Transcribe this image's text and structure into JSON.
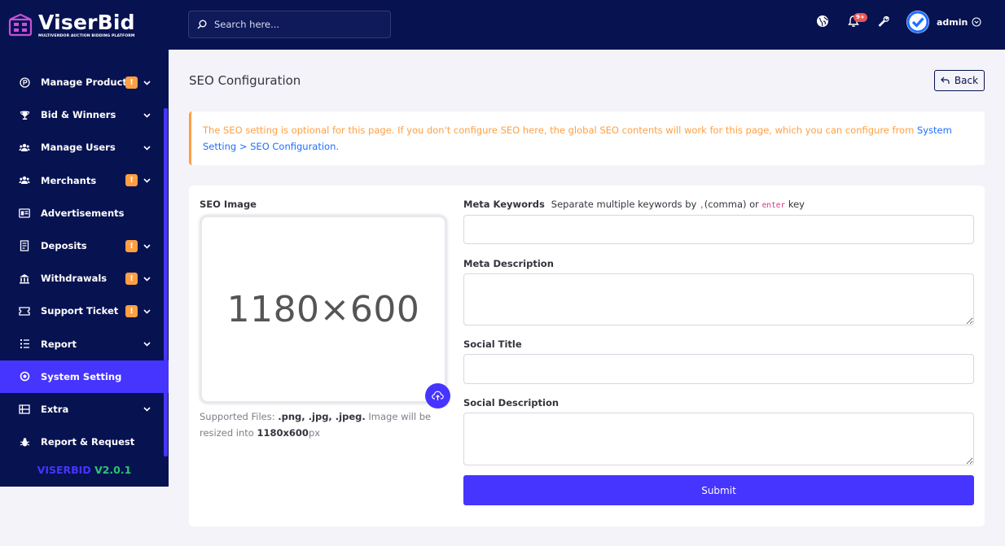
{
  "brand": {
    "name": "ViserBid",
    "tagline": "MULTIVENDOR AUCTION BIDDING PLATFORM"
  },
  "sidebar": {
    "items": [
      {
        "label": "Manage Products",
        "icon": "product-icon",
        "badge": "!",
        "has_chevron": true
      },
      {
        "label": "Bid & Winners",
        "icon": "trophy-icon",
        "badge": "",
        "has_chevron": true
      },
      {
        "label": "Manage Users",
        "icon": "users-icon",
        "badge": "",
        "has_chevron": true
      },
      {
        "label": "Merchants",
        "icon": "merchants-icon",
        "badge": "!",
        "has_chevron": true
      },
      {
        "label": "Advertisements",
        "icon": "ad-icon",
        "badge": "",
        "has_chevron": false
      },
      {
        "label": "Deposits",
        "icon": "deposit-icon",
        "badge": "!",
        "has_chevron": true
      },
      {
        "label": "Withdrawals",
        "icon": "bank-icon",
        "badge": "!",
        "has_chevron": true
      },
      {
        "label": "Support Ticket",
        "icon": "ticket-icon",
        "badge": "!",
        "has_chevron": true
      },
      {
        "label": "Report",
        "icon": "report-icon",
        "badge": "",
        "has_chevron": true
      },
      {
        "label": "System Setting",
        "icon": "settings-icon",
        "badge": "",
        "has_chevron": false,
        "active": true
      },
      {
        "label": "Extra",
        "icon": "server-icon",
        "badge": "",
        "has_chevron": true
      },
      {
        "label": "Report & Request",
        "icon": "bug-icon",
        "badge": "",
        "has_chevron": false
      }
    ],
    "version_name": "VISERBID",
    "version_number": "V2.0.1"
  },
  "topbar": {
    "search_placeholder": "Search here...",
    "notification_count": "9+",
    "admin_name": "admin"
  },
  "page": {
    "title": "SEO Configuration",
    "back_label": "Back"
  },
  "alert": {
    "text": "The SEO setting is optional for this page. If you don't configure SEO here, the global SEO contents will work for this page, which you can configure from ",
    "link_text": "System Setting > SEO Configuration."
  },
  "form": {
    "seo_image_label": "SEO Image",
    "image_placeholder": "1180×600",
    "supported_prefix": "Supported Files: ",
    "supported_types": ".png, .jpg, .jpeg.",
    "supported_middle": " Image will be resized into ",
    "supported_size": "1180x600",
    "supported_suffix": "px",
    "meta_keywords_label": "Meta Keywords",
    "meta_keywords_hint_prefix": "Separate multiple keywords by ",
    "meta_keywords_hint_comma": ",",
    "meta_keywords_hint_middle": "(comma) or ",
    "meta_keywords_hint_enter": "enter",
    "meta_keywords_hint_suffix": " key",
    "meta_keywords_value": "",
    "meta_description_label": "Meta Description",
    "meta_description_value": "",
    "social_title_label": "Social Title",
    "social_title_value": "",
    "social_description_label": "Social Description",
    "social_description_value": "",
    "submit_label": "Submit"
  },
  "colors": {
    "sidebar_bg": "#071251",
    "accent": "#4634ff",
    "warning": "#ff9f43",
    "success": "#28c76f",
    "danger": "#ea5455"
  }
}
